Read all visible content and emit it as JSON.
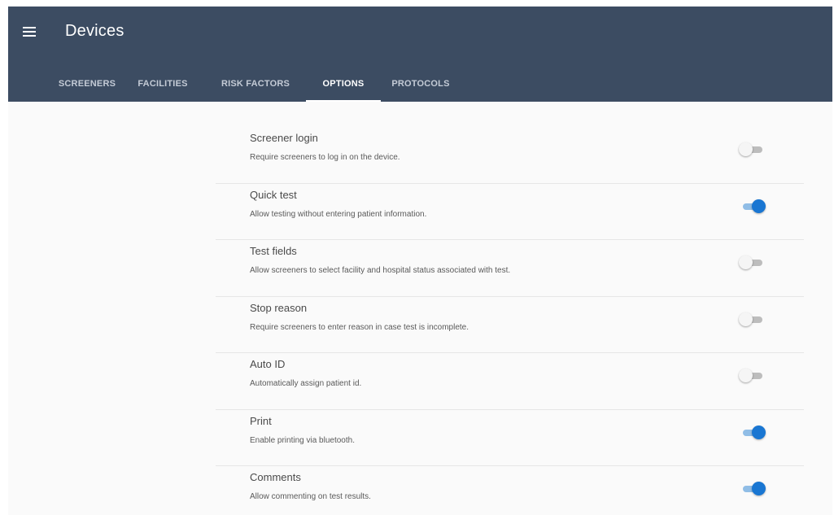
{
  "appbar": {
    "title": "Devices",
    "menu_icon": "hamburger-menu-icon",
    "background": "#3c4c62"
  },
  "tabs": [
    {
      "label": "SCREENERS",
      "active": false
    },
    {
      "label": "FACILITIES",
      "active": false
    },
    {
      "label": "RISK FACTORS",
      "active": false
    },
    {
      "label": "OPTIONS",
      "active": true
    },
    {
      "label": "PROTOCOLS",
      "active": false
    }
  ],
  "options": [
    {
      "title": "Screener login",
      "description": "Require screeners to log in on the device.",
      "enabled": false
    },
    {
      "title": "Quick test",
      "description": "Allow testing without entering patient information.",
      "enabled": true
    },
    {
      "title": "Test fields",
      "description": "Allow screeners to select facility and hospital status associated with test.",
      "enabled": false
    },
    {
      "title": "Stop reason",
      "description": "Require screeners to enter reason in case test is incomplete.",
      "enabled": false
    },
    {
      "title": "Auto ID",
      "description": "Automatically assign patient id.",
      "enabled": false
    },
    {
      "title": "Print",
      "description": "Enable printing via bluetooth.",
      "enabled": true
    },
    {
      "title": "Comments",
      "description": "Allow commenting on test results.",
      "enabled": true
    }
  ],
  "colors": {
    "accent": "#1976d2",
    "toggle_on_track": "#90bde6",
    "toggle_off_track": "#bdbdbd"
  }
}
